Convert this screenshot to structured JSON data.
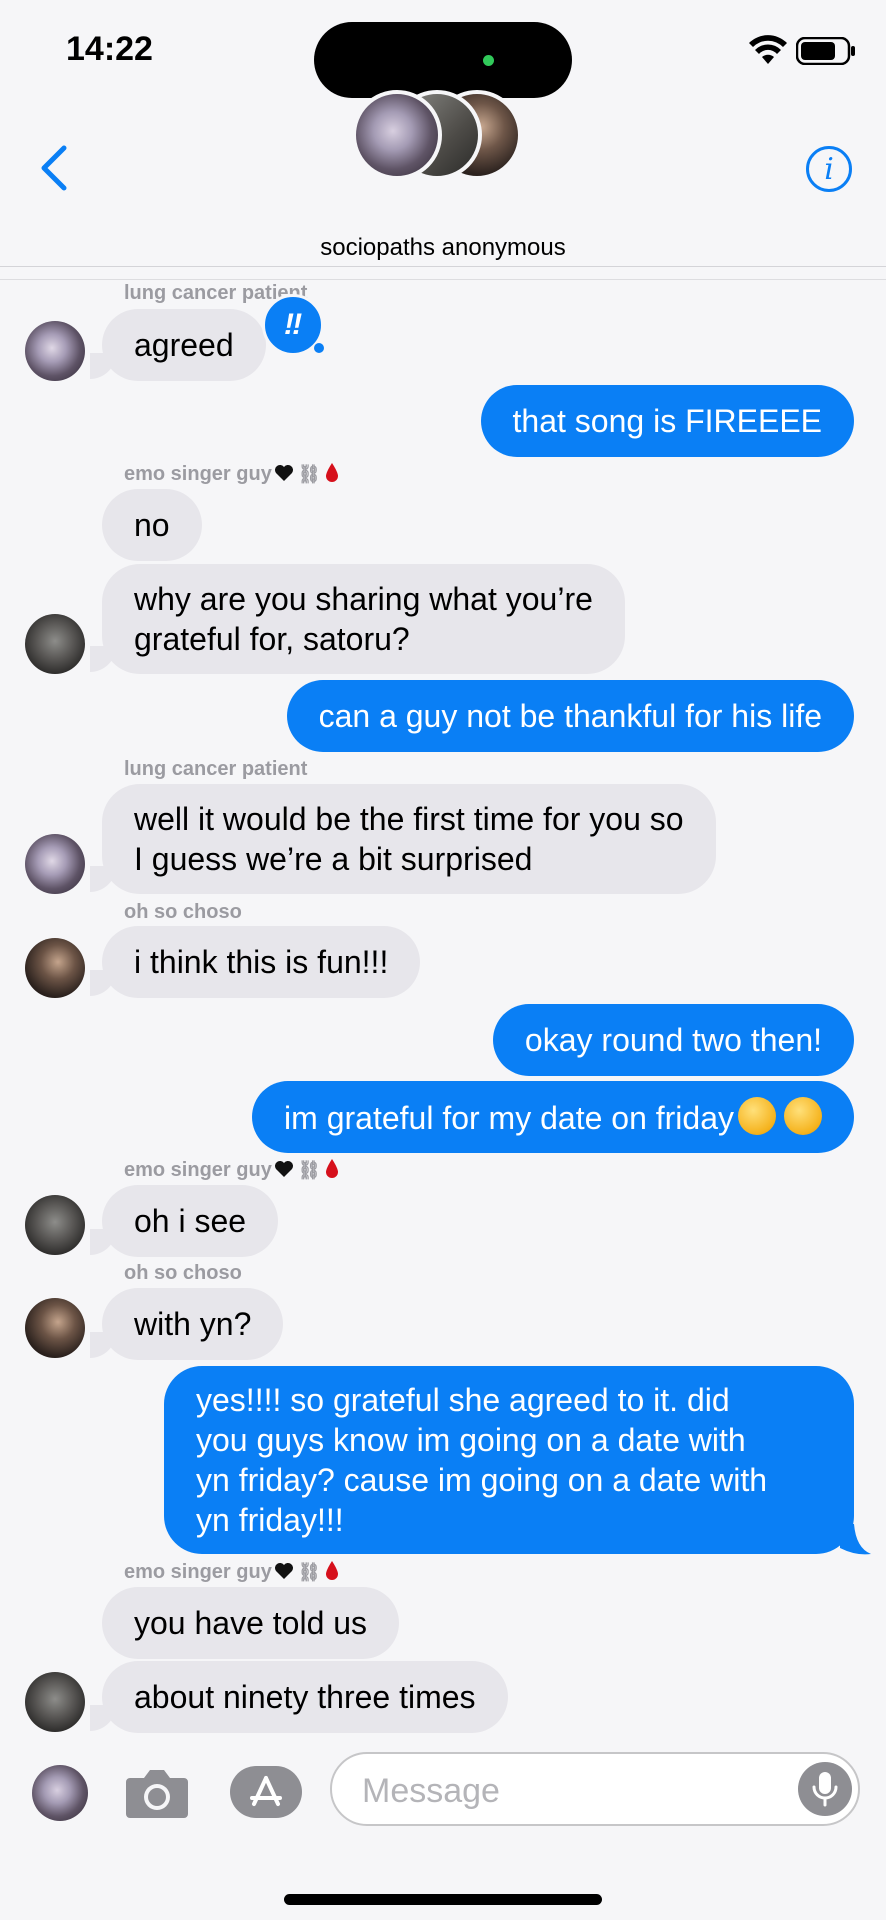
{
  "status_bar": {
    "time": "14:22"
  },
  "header": {
    "title": "sociopaths anonymous",
    "info_label": "i"
  },
  "tapback": {
    "symbol": "‼"
  },
  "messages": [
    {
      "sender": "lung cancer patient",
      "text": "agreed"
    },
    {
      "text": "that song is FIREEEE"
    },
    {
      "sender": "emo singer guy",
      "text": "no"
    },
    {
      "line1": "why are you sharing what you’re",
      "line2": "grateful for, satoru?"
    },
    {
      "text": "can a guy not be thankful for his life"
    },
    {
      "sender": "lung cancer patient",
      "line1": "well it would be the first time for you so",
      "line2": "I guess we’re a bit surprised"
    },
    {
      "sender": "oh so choso",
      "text": "i think this is fun!!!"
    },
    {
      "text": "okay round two then!"
    },
    {
      "text": "im grateful for my date on friday"
    },
    {
      "sender": "emo singer guy",
      "text": "oh i see"
    },
    {
      "sender": "oh so choso",
      "text": "with yn?"
    },
    {
      "line1": "yes!!!! so grateful she agreed to it. did",
      "line2": "you guys know im going on a date with",
      "line3": "yn friday? cause im going on a date with",
      "line4": "yn friday!!!"
    },
    {
      "sender": "emo singer guy",
      "text": "you have told us"
    },
    {
      "text": "about ninety three times"
    }
  ],
  "input_bar": {
    "placeholder": "Message"
  },
  "colors": {
    "accent": "#0a7ff5",
    "incoming_bubble": "#e7e6eb",
    "background": "#f6f6f8"
  }
}
